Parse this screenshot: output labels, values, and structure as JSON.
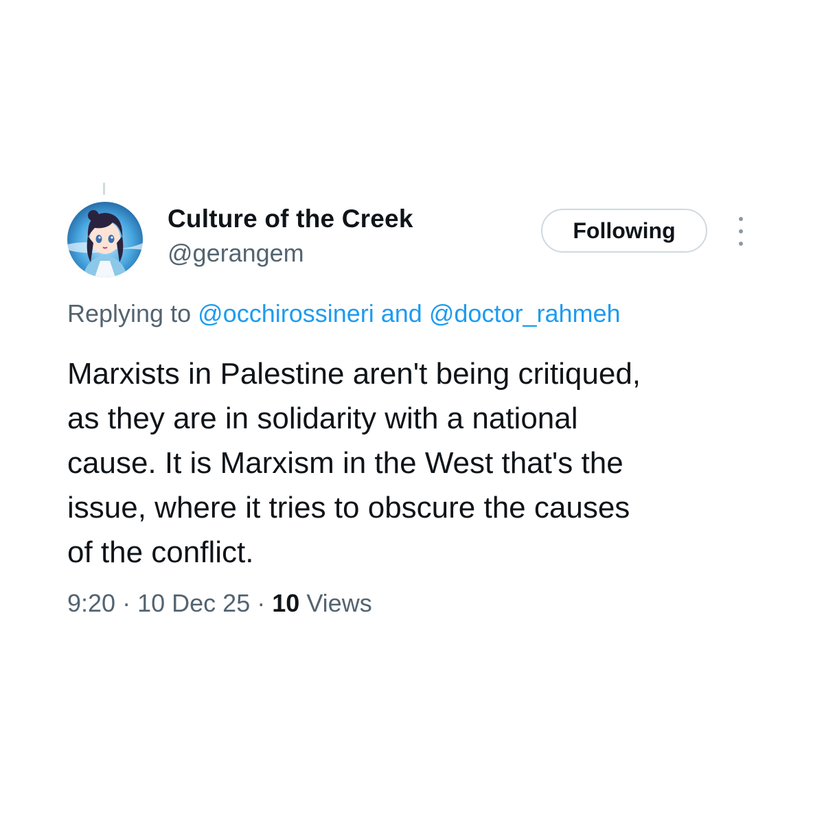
{
  "author": {
    "display_name": "Culture of the Creek",
    "handle": "@gerangem",
    "avatar_icon": "anime-avatar"
  },
  "actions": {
    "follow_label": "Following",
    "more_icon": "more-vertical-icon"
  },
  "reply_context": {
    "prefix": "Replying to",
    "mentions": [
      "@occhirossineri",
      "@doctor_rahmeh"
    ],
    "joiner": "and"
  },
  "tweet": {
    "lines": [
      "Marxists in Palestine aren't being critiqued,",
      "as they are in solidarity with a national",
      "cause. It is Marxism in the West that's the",
      "issue, where it tries to obscure the causes",
      "of the conflict."
    ]
  },
  "meta": {
    "time": "9:20",
    "date": "10 Dec 25",
    "separator": "·",
    "views_count": "10",
    "views_label": "Views"
  },
  "colors": {
    "text": "#0f1419",
    "secondary": "#536471",
    "link": "#1d9bf0",
    "border": "#cfd9de"
  }
}
